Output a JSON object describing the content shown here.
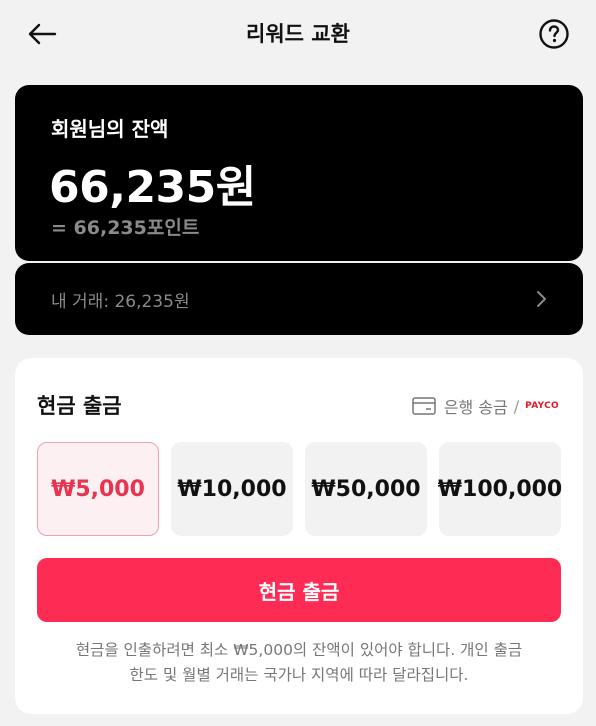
{
  "header": {
    "title": "리워드 교환",
    "back_icon": "arrow-left-icon",
    "help_icon": "question-circle-icon"
  },
  "balance": {
    "label": "회원님의 잔액",
    "amount": "66,235원",
    "points": "= 66,235포인트"
  },
  "transactions": {
    "label": "내 거래: 26,235원",
    "chevron_icon": "chevron-right-icon"
  },
  "withdraw": {
    "title": "현금 출금",
    "method_icon": "card-icon",
    "method_label": "은행 송금",
    "method_separator": "/",
    "payco_logo": "PAYCO",
    "options": [
      {
        "label": "₩5,000",
        "selected": true
      },
      {
        "label": "₩10,000",
        "selected": false
      },
      {
        "label": "₩50,000",
        "selected": false
      },
      {
        "label": "₩100,000",
        "selected": false
      }
    ],
    "button_label": "현금 출금",
    "notice_line1": "현금을 인출하려면 최소 ₩5,000의 잔액이 있어야 합니다. 개인 출금",
    "notice_line2": "한도 및 월별 거래는 국가나 지역에 따라 달라집니다."
  },
  "colors": {
    "accent": "#fe2c55",
    "selected_text": "#e8344e",
    "selected_bg": "#fdf0f2",
    "card_bg": "#000000",
    "page_bg": "#f2f2f2"
  }
}
